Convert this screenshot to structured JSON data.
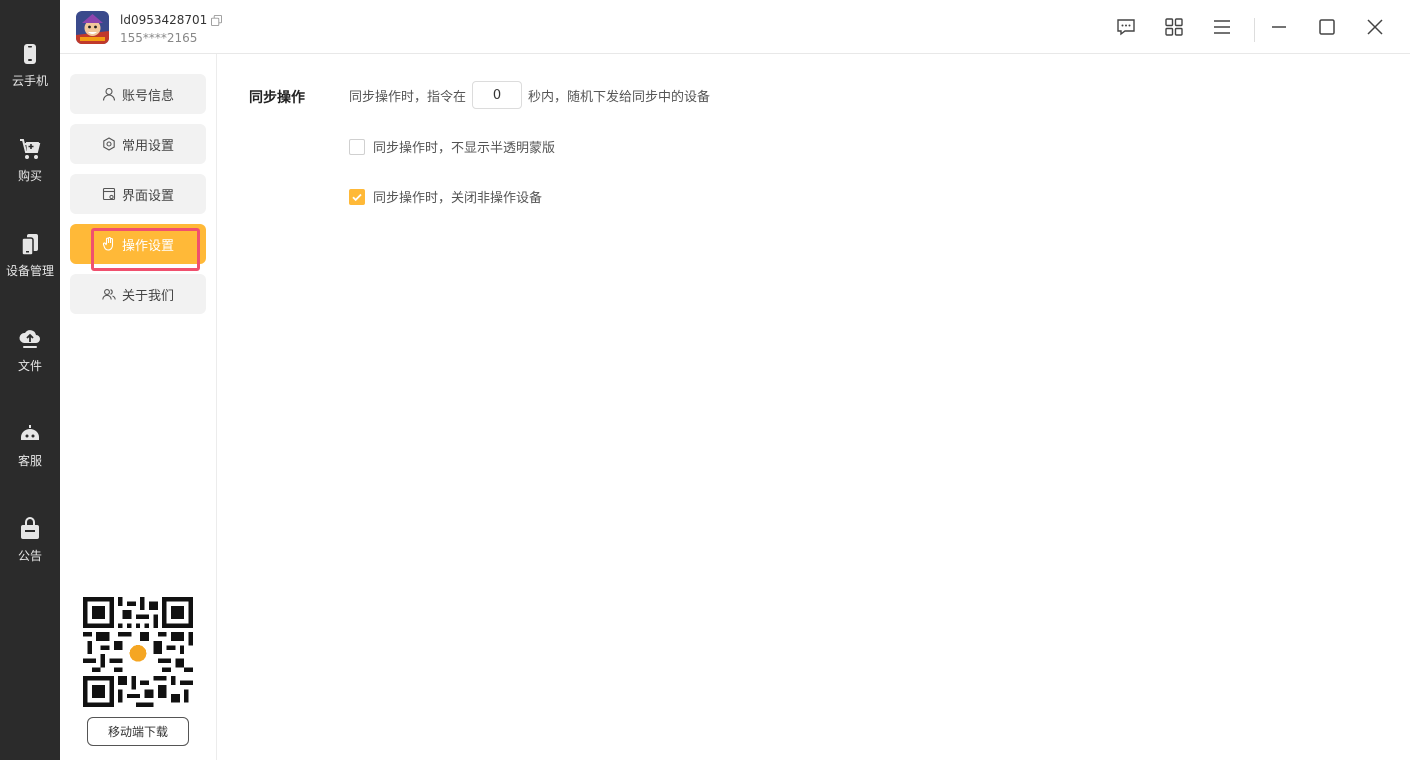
{
  "rail": {
    "items": [
      {
        "label": "云手机",
        "icon": "phone-icon"
      },
      {
        "label": "购买",
        "icon": "cart-icon"
      },
      {
        "label": "设备管理",
        "icon": "devices-icon"
      },
      {
        "label": "文件",
        "icon": "cloud-upload-icon"
      },
      {
        "label": "客服",
        "icon": "support-icon"
      },
      {
        "label": "公告",
        "icon": "notice-icon"
      }
    ]
  },
  "header": {
    "username": "ld0953428701",
    "phone": "155****2165"
  },
  "sidebar": {
    "items": [
      {
        "label": "账号信息",
        "icon": "user-icon"
      },
      {
        "label": "常用设置",
        "icon": "gear-icon"
      },
      {
        "label": "界面设置",
        "icon": "window-settings-icon"
      },
      {
        "label": "操作设置",
        "icon": "hand-icon"
      },
      {
        "label": "关于我们",
        "icon": "users-icon"
      }
    ],
    "active_index": 3,
    "download_label": "移动端下载"
  },
  "content": {
    "section_title": "同步操作",
    "row1_prefix": "同步操作时，指令在",
    "row1_value": "0",
    "row1_suffix": "秒内，随机下发给同步中的设备",
    "checkbox1": {
      "label": "同步操作时，不显示半透明蒙版",
      "checked": false
    },
    "checkbox2": {
      "label": "同步操作时，关闭非操作设备",
      "checked": true
    }
  },
  "colors": {
    "accent": "#ffb938",
    "rail_bg": "#2b2b2b",
    "highlight_border": "#f0506e"
  }
}
